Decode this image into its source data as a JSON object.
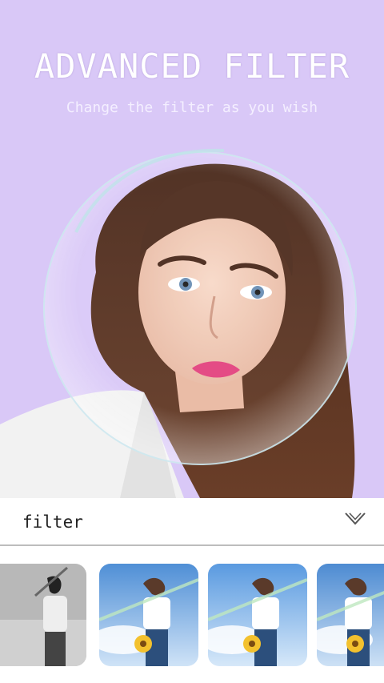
{
  "hero": {
    "title": "ADVANCED FILTER",
    "subtitle": "Change the filter as you wish",
    "background_color": "#d9c8f7"
  },
  "filter_bar": {
    "label": "filter",
    "toggle_icon": "chevron-down-icon"
  },
  "thumbnails": {
    "prev_icon": "chevron-left-icon",
    "items": [
      {
        "style": "grayscale"
      },
      {
        "style": "blue-sky"
      },
      {
        "style": "blue-sky"
      },
      {
        "style": "blue-sky"
      }
    ]
  }
}
